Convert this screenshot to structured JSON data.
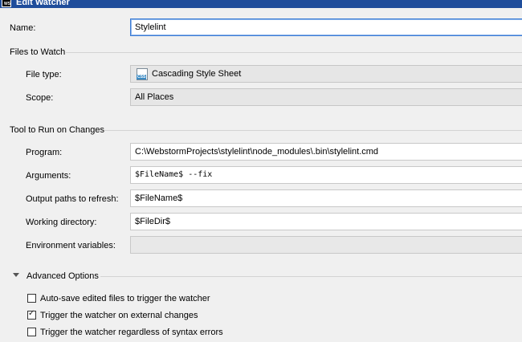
{
  "window": {
    "title": "Edit Watcher",
    "app_icon_text": "WS"
  },
  "name": {
    "label": "Name:",
    "value": "Stylelint"
  },
  "files_to_watch": {
    "header": "Files to Watch",
    "file_type_label": "File type:",
    "file_type_value": "Cascading Style Sheet",
    "file_type_icon_text": "CSS",
    "scope_label": "Scope:",
    "scope_value": "All Places"
  },
  "tool": {
    "header": "Tool to Run on Changes",
    "program_label": "Program:",
    "program_value": "C:\\WebstormProjects\\stylelint\\node_modules\\.bin\\stylelint.cmd",
    "arguments_label": "Arguments:",
    "arguments_value": "$FileName$ --fix",
    "output_label": "Output paths to refresh:",
    "output_value": "$FileName$",
    "workdir_label": "Working directory:",
    "workdir_value": "$FileDir$",
    "env_label": "Environment variables:",
    "env_value": ""
  },
  "advanced": {
    "header": "Advanced Options",
    "options": [
      {
        "label": "Auto-save edited files to trigger the watcher",
        "checked": false
      },
      {
        "label": "Trigger the watcher on external changes",
        "checked": true
      },
      {
        "label": "Trigger the watcher regardless of syntax errors",
        "checked": false
      }
    ]
  }
}
